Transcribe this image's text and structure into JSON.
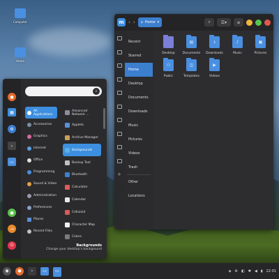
{
  "desktop": {
    "icons": [
      {
        "label": "Computer",
        "icon": "computer-icon",
        "color": "#4a8fe0"
      },
      {
        "label": "Home",
        "icon": "home-folder-icon",
        "color": "#4a8fe0"
      }
    ]
  },
  "file_manager": {
    "location": "Home",
    "sidebar": [
      "Recent",
      "Starred",
      "Home",
      "Desktop",
      "Documents",
      "Downloads",
      "Music",
      "Pictures",
      "Videos",
      "Trash",
      "Other Locations"
    ],
    "active": "Home",
    "files": [
      {
        "name": "Desktop",
        "icon": "desktop-folder-icon",
        "glyph": ""
      },
      {
        "name": "Documents",
        "icon": "documents-folder-icon",
        "glyph": "▤"
      },
      {
        "name": "Downloads",
        "icon": "downloads-folder-icon",
        "glyph": "↓"
      },
      {
        "name": "Music",
        "icon": "music-folder-icon",
        "glyph": "♪"
      },
      {
        "name": "Pictures",
        "icon": "pictures-folder-icon",
        "glyph": "▣"
      },
      {
        "name": "Public",
        "icon": "public-folder-icon",
        "glyph": "⚇"
      },
      {
        "name": "Templates",
        "icon": "templates-folder-icon",
        "glyph": "◫"
      },
      {
        "name": "Videos",
        "icon": "videos-folder-icon",
        "glyph": "▶"
      }
    ]
  },
  "menu": {
    "categories": [
      "All Applications",
      "Accessories",
      "Graphics",
      "Internet",
      "Office",
      "Programming",
      "Sound & Video",
      "Administration",
      "Preferences",
      "Places",
      "Recent Files"
    ],
    "active_category": "All Applications",
    "apps": [
      {
        "name": "Advanced Network ...",
        "color": "#8a8f98"
      },
      {
        "name": "Applets",
        "color": "#5b8fd8"
      },
      {
        "name": "Archive Manager",
        "color": "#c9a15a"
      },
      {
        "name": "Backgrounds",
        "color": "#5ab0e0"
      },
      {
        "name": "Backup Tool",
        "color": "#c0c0c0"
      },
      {
        "name": "Bluetooth",
        "color": "#3d7fcf"
      },
      {
        "name": "Calculator",
        "color": "#e05b5b"
      },
      {
        "name": "Calendar",
        "color": "#e8e8e8"
      },
      {
        "name": "Celluloid",
        "color": "#d85a5a"
      },
      {
        "name": "Character Map",
        "color": "#f0f0f0"
      },
      {
        "name": "Colors",
        "color": "#7a7a7a"
      }
    ],
    "active_app": "Backgrounds",
    "description_title": "Backgrounds",
    "description_text": "Change your desktop's background"
  },
  "panel": {
    "time": "22:01"
  },
  "colors": {
    "accent": "#3d8fdf",
    "close": "#e2574c",
    "minimize": "#f2b43b",
    "maximize": "#5ac24e"
  }
}
